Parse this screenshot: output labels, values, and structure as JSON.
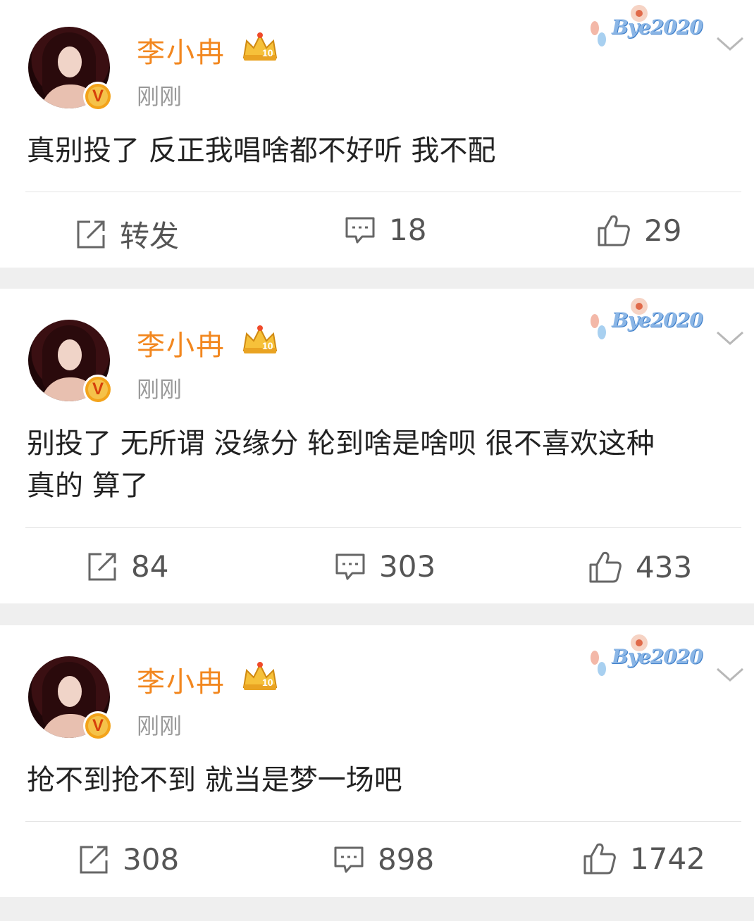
{
  "posts": [
    {
      "author": "李小冉",
      "time": "刚刚",
      "badge_label": "10",
      "decoration": "Bye2020",
      "content_lines": [
        "真别投了 反正我唱啥都不好听 我不配"
      ],
      "repost": "转发",
      "comments": "18",
      "likes": "29"
    },
    {
      "author": "李小冉",
      "time": "刚刚",
      "badge_label": "10",
      "decoration": "Bye2020",
      "content_lines": [
        "别投了 无所谓 没缘分 轮到啥是啥呗 很不喜欢这种",
        "真的  算了"
      ],
      "repost": "84",
      "comments": "303",
      "likes": "433"
    },
    {
      "author": "李小冉",
      "time": "刚刚",
      "badge_label": "10",
      "decoration": "Bye2020",
      "content_lines": [
        "抢不到抢不到 就当是梦一场吧"
      ],
      "repost": "308",
      "comments": "898",
      "likes": "1742"
    }
  ],
  "verified_mark": "V",
  "icons": [
    "share-icon",
    "comment-icon",
    "like-icon",
    "chevron-down-icon",
    "crown-badge-icon",
    "verified-badge-icon"
  ],
  "colors": {
    "name": "#f2871f",
    "time": "#9a9a9a",
    "text": "#222222",
    "action": "#555555",
    "badge": "#f3a31b",
    "background": "#efefef"
  }
}
